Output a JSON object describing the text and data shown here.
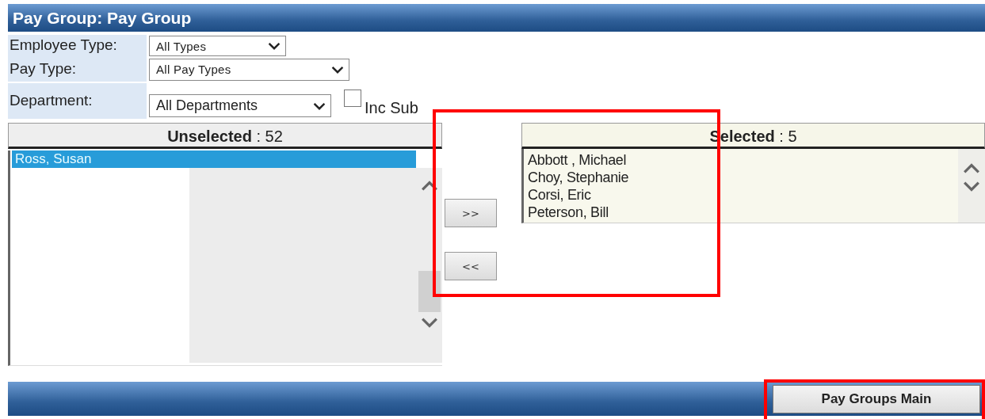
{
  "window": {
    "title": "Pay Group: Pay Group"
  },
  "filters": [
    {
      "label": "Employee Type:",
      "value": "All Types",
      "kind": "short"
    },
    {
      "label": "Pay Type:",
      "value": "All Pay Types",
      "kind": "long"
    },
    {
      "label": "Department:",
      "value": "All Departments",
      "kind": "dept",
      "checkbox": {
        "label": "Inc Sub",
        "checked": false
      }
    }
  ],
  "unselected": {
    "heading": "Unselected",
    "count": ": 52",
    "items": [
      {
        "label": "Ross, Susan",
        "selected": true
      }
    ]
  },
  "transfer": {
    "highlighted": true,
    "buttons": [
      ">>",
      "<<"
    ]
  },
  "selected": {
    "heading": "Selected",
    "count": ": 5",
    "items": [
      {
        "label": "Abbott , Michael",
        "selected": false
      },
      {
        "label": "Choy, Stephanie",
        "selected": false
      },
      {
        "label": "Corsi, Eric",
        "selected": false
      },
      {
        "label": "Peterson, Bill",
        "selected": false
      }
    ]
  },
  "footer": {
    "button": {
      "label": "Pay Groups Main",
      "highlighted": true
    }
  }
}
